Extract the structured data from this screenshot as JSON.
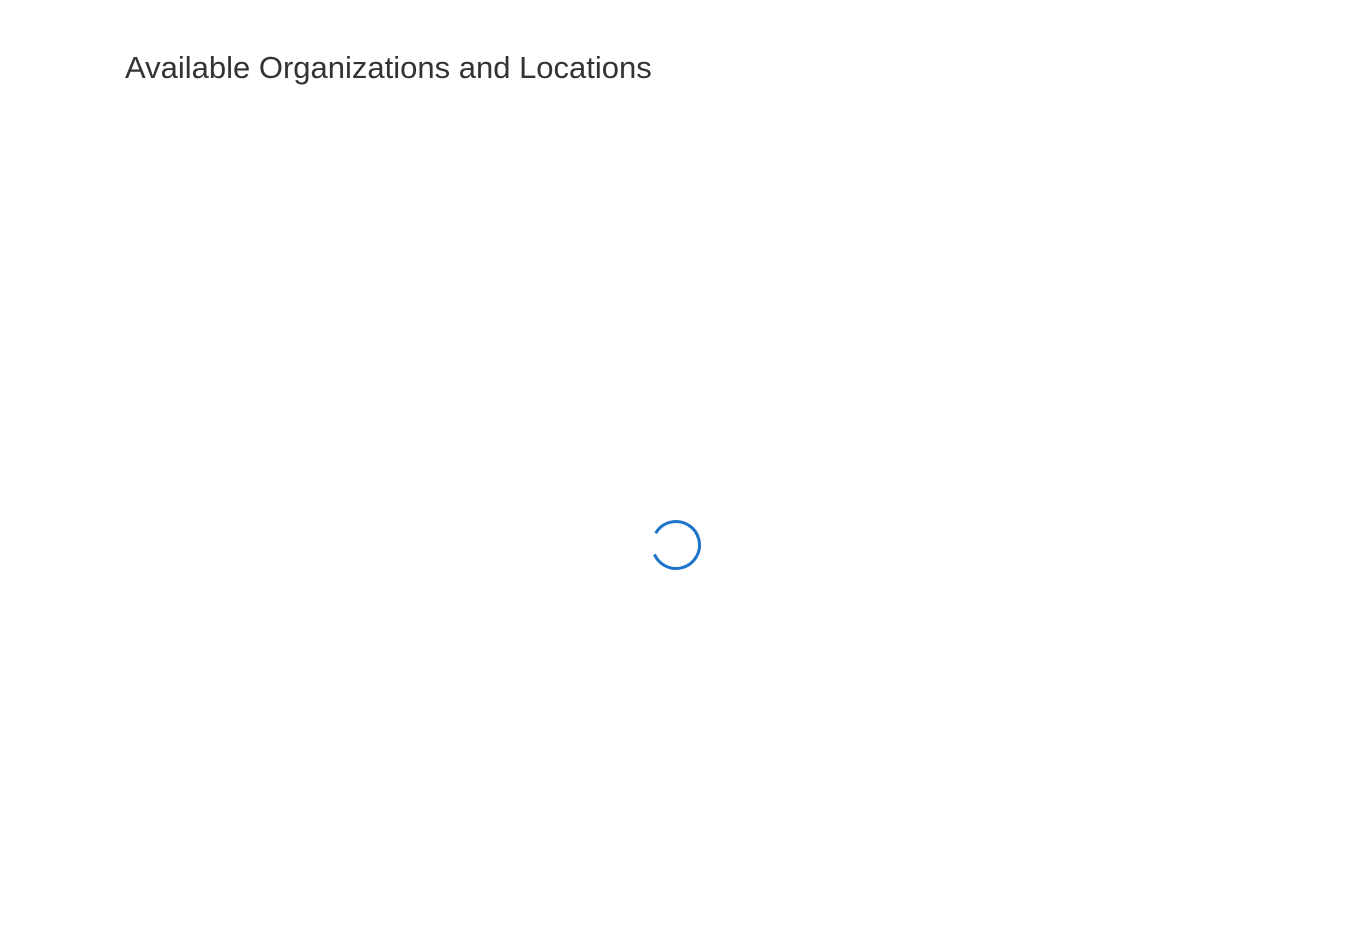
{
  "header": {
    "title": "Available Organizations and Locations"
  },
  "loading": {
    "icon": "loading-spinner-icon",
    "progress_arc_fraction": 0.85
  },
  "colors": {
    "title_text": "#333333",
    "spinner": "#1f73c9",
    "background": "#ffffff"
  }
}
